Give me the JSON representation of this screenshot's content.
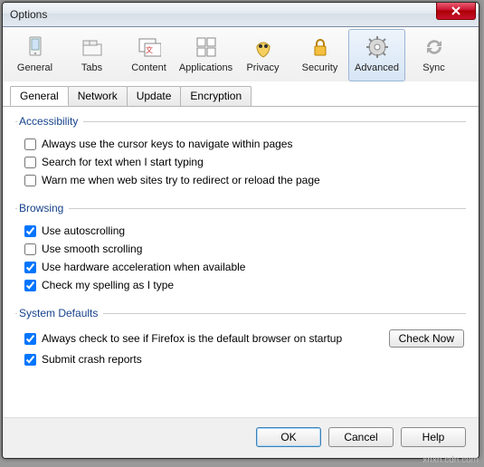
{
  "window": {
    "title": "Options"
  },
  "toolbar": {
    "items": [
      {
        "label": "General"
      },
      {
        "label": "Tabs"
      },
      {
        "label": "Content"
      },
      {
        "label": "Applications"
      },
      {
        "label": "Privacy"
      },
      {
        "label": "Security"
      },
      {
        "label": "Advanced"
      },
      {
        "label": "Sync"
      }
    ],
    "selected_index": 6
  },
  "subtabs": {
    "items": [
      {
        "label": "General"
      },
      {
        "label": "Network"
      },
      {
        "label": "Update"
      },
      {
        "label": "Encryption"
      }
    ],
    "active_index": 0
  },
  "sections": {
    "accessibility": {
      "legend": "Accessibility",
      "items": [
        {
          "label": "Always use the cursor keys to navigate within pages",
          "checked": false
        },
        {
          "label": "Search for text when I start typing",
          "checked": false
        },
        {
          "label": "Warn me when web sites try to redirect or reload the page",
          "checked": false
        }
      ]
    },
    "browsing": {
      "legend": "Browsing",
      "items": [
        {
          "label": "Use autoscrolling",
          "checked": true
        },
        {
          "label": "Use smooth scrolling",
          "checked": false
        },
        {
          "label": "Use hardware acceleration when available",
          "checked": true
        },
        {
          "label": "Check my spelling as I type",
          "checked": true
        }
      ]
    },
    "defaults": {
      "legend": "System Defaults",
      "items": [
        {
          "label": "Always check to see if Firefox is the default browser on startup",
          "checked": true
        },
        {
          "label": "Submit crash reports",
          "checked": true
        }
      ],
      "check_now": "Check Now"
    }
  },
  "buttons": {
    "ok": "OK",
    "cancel": "Cancel",
    "help": "Help"
  },
  "watermark": "xnxn.cdn.com"
}
